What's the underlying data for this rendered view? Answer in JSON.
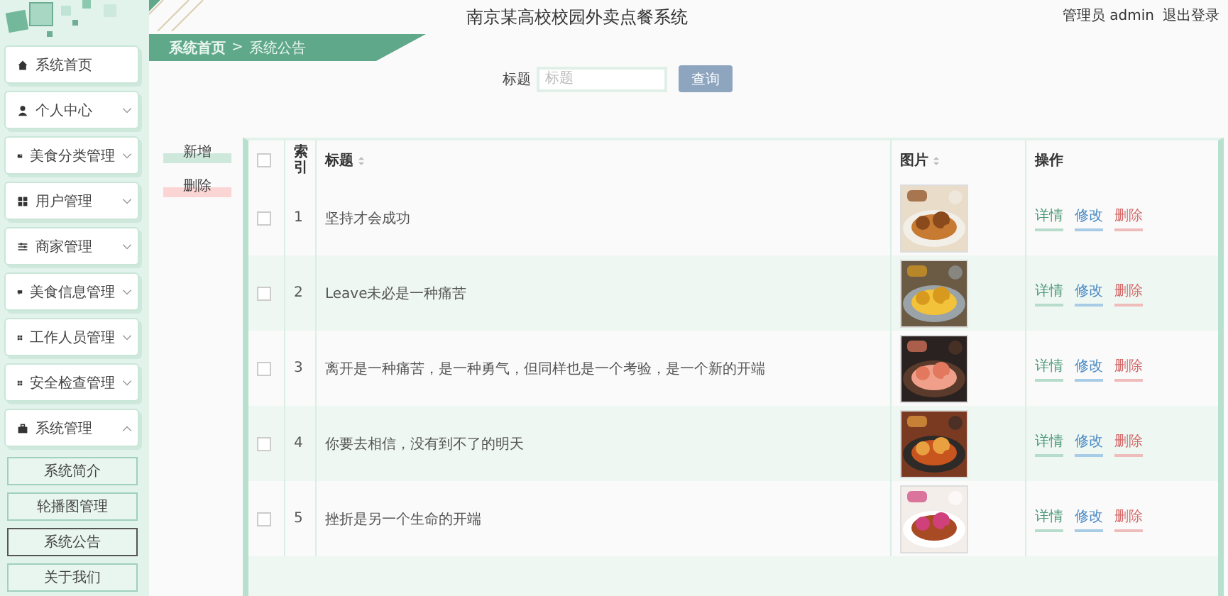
{
  "header": {
    "title": "南京某高校校园外卖点餐系统",
    "user": "管理员 admin",
    "logout": "退出登录"
  },
  "breadcrumb": [
    "系统首页",
    ">",
    "系统公告"
  ],
  "sidebar": {
    "items": [
      {
        "label": "系统首页"
      },
      {
        "label": "个人中心",
        "expanded": false
      },
      {
        "label": "美食分类管理",
        "expanded": false
      },
      {
        "label": "用户管理",
        "expanded": false
      },
      {
        "label": "商家管理",
        "expanded": false
      },
      {
        "label": "美食信息管理",
        "expanded": false
      },
      {
        "label": "工作人员管理",
        "expanded": false
      },
      {
        "label": "安全检查管理",
        "expanded": false
      },
      {
        "label": "系统管理",
        "expanded": true,
        "children": [
          {
            "label": "系统简介",
            "selected": false
          },
          {
            "label": "轮播图管理",
            "selected": false
          },
          {
            "label": "系统公告",
            "selected": true
          },
          {
            "label": "关于我们",
            "selected": false
          }
        ]
      }
    ]
  },
  "search": {
    "label": "标题",
    "placeholder": "标题",
    "button": "查询"
  },
  "actions": [
    "新增",
    "删除"
  ],
  "table": {
    "columns": [
      "索引",
      "标题",
      "图片",
      "操作"
    ],
    "header_checked": false,
    "rows": [
      {
        "checked": false,
        "index": "1",
        "title": "坚持才会成功",
        "picture": {
          "kind": "picture"
        },
        "actions": [
          "详情",
          "修改",
          "删除"
        ]
      },
      {
        "checked": false,
        "index": "2",
        "title": "Leave未必是一种痛苦",
        "picture": {
          "kind": "picture"
        },
        "actions": [
          "详情",
          "修改",
          "删除"
        ]
      },
      {
        "checked": false,
        "index": "3",
        "title": "离开是一种痛苦，是一种勇气，但同样也是一个考验，是一个新的开端",
        "picture": {
          "kind": "picture"
        },
        "actions": [
          "详情",
          "修改",
          "删除"
        ]
      },
      {
        "checked": false,
        "index": "4",
        "title": "你要去相信，没有到不了的明天",
        "picture": {
          "kind": "picture"
        },
        "actions": [
          "详情",
          "修改",
          "删除"
        ]
      },
      {
        "checked": false,
        "index": "5",
        "title": "挫折是另一个生命的开端",
        "picture": {
          "kind": "picture"
        },
        "actions": [
          "详情",
          "修改",
          "删除"
        ]
      }
    ]
  }
}
